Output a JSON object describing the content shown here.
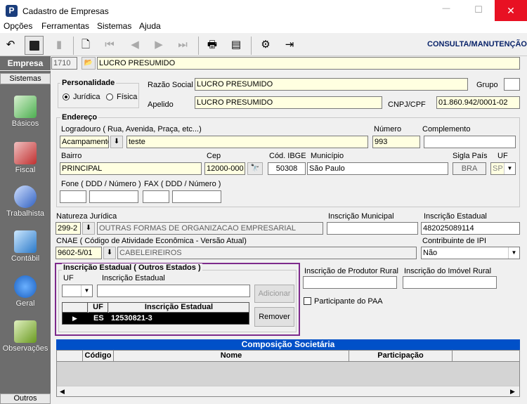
{
  "window": {
    "title": "Cadastro de Empresas",
    "minimize": "—",
    "maximize": "☐",
    "close": "✕",
    "app_icon_letter": "P"
  },
  "menu": [
    "Opções",
    "Ferramentas",
    "Sistemas",
    "Ajuda"
  ],
  "toolbar": {
    "mode_label": "CONSULTA/MANUTENÇÃO"
  },
  "empresa": {
    "label": "Empresa",
    "code": "1710",
    "name": "LUCRO PRESUMIDO"
  },
  "sidebar": {
    "header": "Sistemas",
    "items": [
      {
        "label": "Básicos",
        "icon": "basicos-icon"
      },
      {
        "label": "Fiscal",
        "icon": "fiscal-icon"
      },
      {
        "label": "Trabalhista",
        "icon": "trabalhista-icon"
      },
      {
        "label": "Contábil",
        "icon": "contabil-icon"
      },
      {
        "label": "Geral",
        "icon": "geral-icon"
      },
      {
        "label": "Observações",
        "icon": "observacoes-icon"
      }
    ],
    "footer": "Outros"
  },
  "personalidade": {
    "title": "Personalidade",
    "options": [
      "Jurídica",
      "Física"
    ],
    "selected": "Jurídica"
  },
  "razao_social": {
    "label": "Razão Social",
    "value": "LUCRO PRESUMIDO"
  },
  "grupo": {
    "label": "Grupo",
    "value": ""
  },
  "apelido": {
    "label": "Apelido",
    "value": "LUCRO PRESUMIDO"
  },
  "cnpj": {
    "label": "CNPJ/CPF",
    "value": "01.860.942/0001-02"
  },
  "endereco": {
    "title": "Endereço",
    "logradouro_label": "Logradouro ( Rua, Avenida, Praça, etc...)",
    "logradouro_tipo": "Acampamento",
    "logradouro_value": "teste",
    "numero_label": "Número",
    "numero_value": "993",
    "complemento_label": "Complemento",
    "complemento_value": "",
    "bairro_label": "Bairro",
    "bairro_value": "PRINCIPAL",
    "cep_label": "Cep",
    "cep_value": "12000-000",
    "ibge_label": "Cód. IBGE",
    "ibge_value": "50308",
    "municipio_label": "Município",
    "municipio_value": "São Paulo",
    "sigla_pais_label": "Sigla País",
    "sigla_pais_value": "BRA",
    "uf_label": "UF",
    "uf_value": "SP",
    "fone_label": "Fone ( DDD / Número )",
    "fax_label": "FAX ( DDD / Número )"
  },
  "natureza": {
    "label": "Natureza Jurídica",
    "code": "299-2",
    "desc": "OUTRAS FORMAS DE ORGANIZACAO EMPRESARIAL"
  },
  "inscricao_municipal": {
    "label": "Inscrição Municipal",
    "value": ""
  },
  "inscricao_estadual": {
    "label": "Inscrição Estadual",
    "value": "482025089114"
  },
  "cnae": {
    "label": "CNAE ( Código de Atividade Econômica - Versão Atual)",
    "code": "9602-5/01",
    "desc": "CABELEIREIROS"
  },
  "contribuinte_ipi": {
    "label": "Contribuinte de IPI",
    "value": "Não"
  },
  "ie_outros": {
    "title": "Inscrição Estadual ( Outros Estados )",
    "uf_label": "UF",
    "uf_value": "",
    "ie_label": "Inscrição Estadual",
    "ie_value": "",
    "add_button": "Adicionar",
    "remove_button": "Remover",
    "columns": [
      "UF",
      "Inscrição Estadual"
    ],
    "rows": [
      {
        "uf": "ES",
        "ie": "12530821-3"
      }
    ]
  },
  "produtor_rural": {
    "label": "Inscrição de Produtor Rural",
    "value": ""
  },
  "imovel_rural": {
    "label": "Inscrição do Imóvel Rural",
    "value": ""
  },
  "paa": {
    "label": "Participante do PAA",
    "checked": false
  },
  "composicao": {
    "title": "Composição Societária",
    "columns": [
      "Código",
      "Nome",
      "Participação"
    ]
  },
  "colors": {
    "title_bar": "#ffffff",
    "close_hover": "#e81123",
    "sidebar": "#6d6d6d",
    "mode_text": "#0a246a",
    "section_header": "#0050c8",
    "highlight_border": "#7d2a8c",
    "yellow_field": "#ffffe1"
  }
}
